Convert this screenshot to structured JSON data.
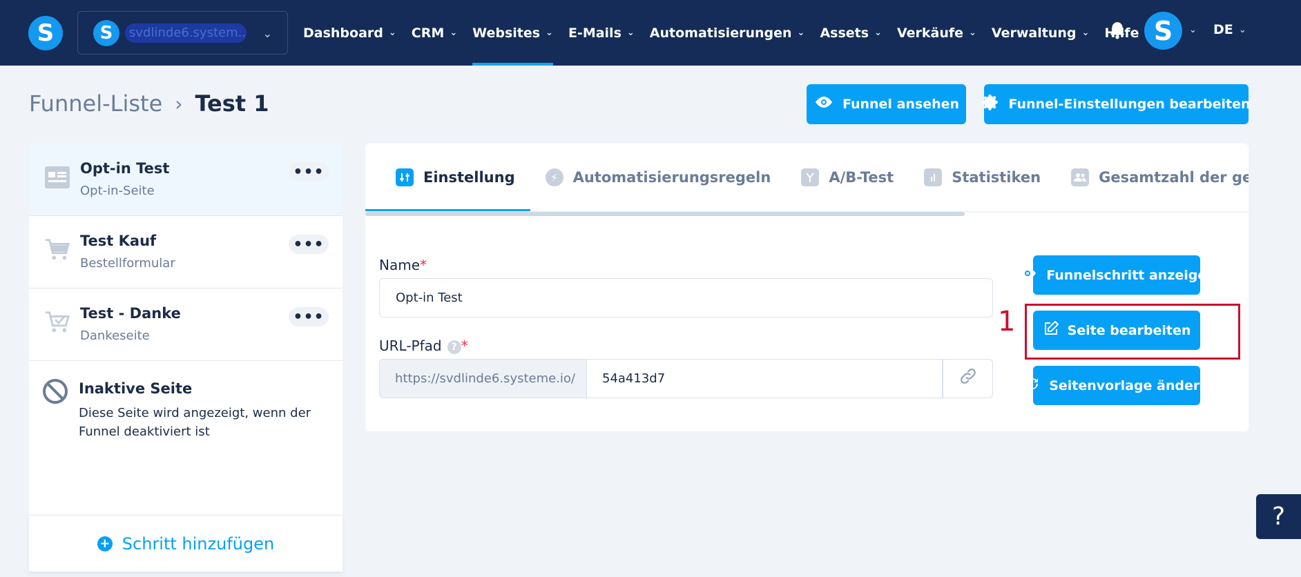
{
  "nav": {
    "logo": "S",
    "workspace_logo": "S",
    "workspace_name": "svdlinde6.system...",
    "items": [
      {
        "label": "Dashboard"
      },
      {
        "label": "CRM"
      },
      {
        "label": "Websites",
        "active": true
      },
      {
        "label": "E-Mails"
      },
      {
        "label": "Automatisierungen"
      },
      {
        "label": "Assets"
      },
      {
        "label": "Verkäufe"
      },
      {
        "label": "Verwaltung"
      },
      {
        "label": "Hilfe"
      }
    ],
    "avatar_letter": "S",
    "language": "DE"
  },
  "header": {
    "breadcrumb_parent": "Funnel-Liste",
    "breadcrumb_current": "Test 1",
    "view_funnel_label": "Funnel ansehen",
    "edit_settings_label": "Funnel-Einstellungen bearbeiten"
  },
  "sidebar": {
    "steps": [
      {
        "title": "Opt-in Test",
        "subtitle": "Opt-in-Seite",
        "icon": "optin-page-icon"
      },
      {
        "title": "Test Kauf",
        "subtitle": "Bestellformular",
        "icon": "cart-icon"
      },
      {
        "title": "Test - Danke",
        "subtitle": "Dankeseite",
        "icon": "cart-check-icon"
      }
    ],
    "inactive_title": "Inaktive Seite",
    "inactive_desc": "Diese Seite wird angezeigt, wenn der Funnel deaktiviert ist",
    "add_step_label": "Schritt hinzufügen"
  },
  "tabs": [
    {
      "label": "Einstellung",
      "icon": "settings-sliders-icon",
      "active": true
    },
    {
      "label": "Automatisierungsregeln",
      "icon": "lightning-icon"
    },
    {
      "label": "A/B-Test",
      "icon": "split-icon"
    },
    {
      "label": "Statistiken",
      "icon": "bar-chart-icon"
    },
    {
      "label": "Gesamtzahl der gesendeten Le",
      "icon": "users-icon"
    }
  ],
  "form": {
    "name_label": "Name",
    "name_value": "Opt-in Test",
    "url_label": "URL-Pfad",
    "url_prefix": "https://svdlinde6.systeme.io/",
    "url_value": "54a413d7",
    "required_mark": "*",
    "help_mark": "?"
  },
  "actions": {
    "show_step_label": "Funnelschritt anzeigen",
    "edit_page_label": "Seite bearbeiten",
    "change_template_label": "Seitenvorlage ändern"
  },
  "annotation": {
    "marker": "1",
    "color": "#c8102e"
  },
  "help_fab": "?",
  "colors": {
    "nav_bg": "#142c57",
    "accent": "#07a0f7",
    "page_bg": "#f0f4f9"
  }
}
